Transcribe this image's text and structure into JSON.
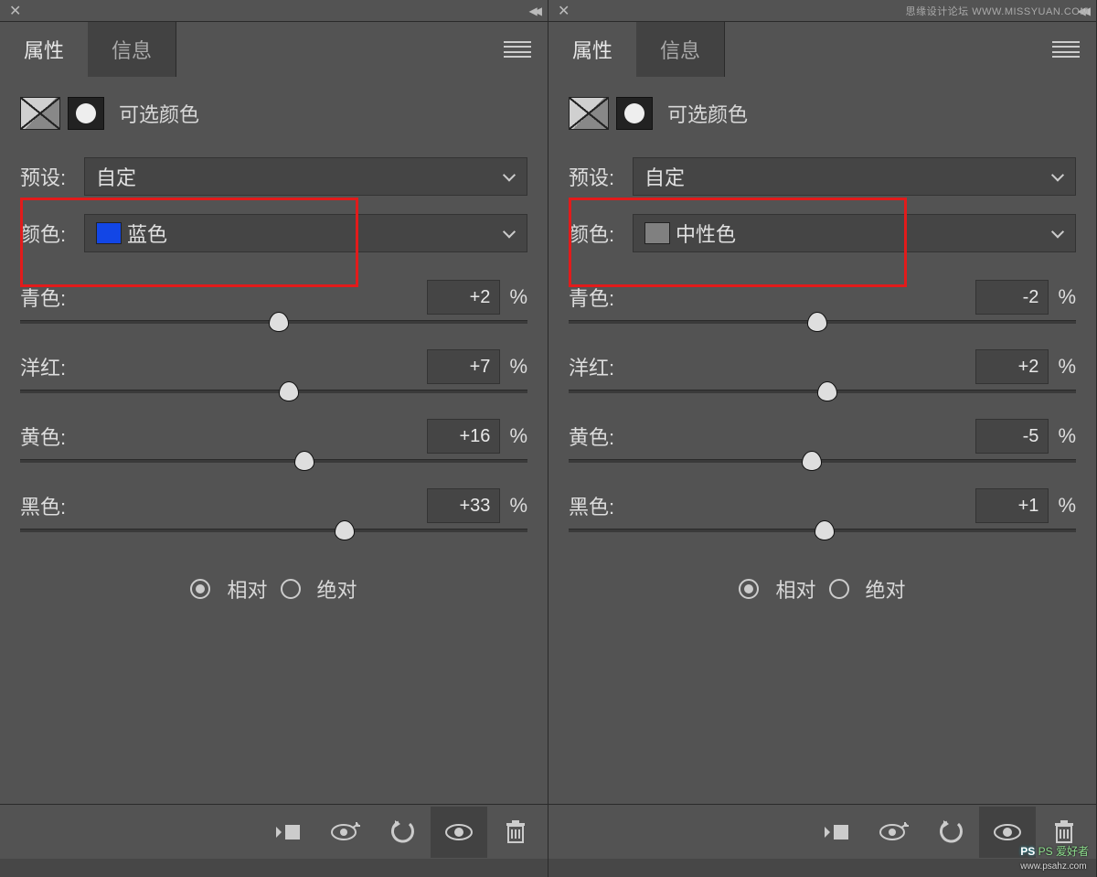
{
  "watermarks": {
    "top": "思缘设计论坛 WWW.MISSYUAN.COM",
    "bottom_brand": "PS 爱好者",
    "bottom_url": "www.psahz.com"
  },
  "shared": {
    "tabs": {
      "properties": "属性",
      "info": "信息"
    },
    "title": "可选颜色",
    "preset_label": "预设:",
    "preset_value": "自定",
    "color_label": "颜色:",
    "slider_labels": {
      "cyan": "青色:",
      "magenta": "洋红:",
      "yellow": "黄色:",
      "black": "黑色:"
    },
    "percent": "%",
    "mode": {
      "relative": "相对",
      "absolute": "绝对"
    }
  },
  "left": {
    "color_name": "蓝色",
    "swatch": "#1246e6",
    "values": {
      "cyan": "+2",
      "magenta": "+7",
      "yellow": "+16",
      "black": "+33"
    },
    "thumbs": {
      "cyan": 51,
      "magenta": 53,
      "yellow": 56,
      "black": 64
    }
  },
  "right": {
    "color_name": "中性色",
    "swatch": "#808080",
    "values": {
      "cyan": "-2",
      "magenta": "+2",
      "yellow": "-5",
      "black": "+1"
    },
    "thumbs": {
      "cyan": 49,
      "magenta": 51,
      "yellow": 48,
      "black": 50.5
    }
  }
}
